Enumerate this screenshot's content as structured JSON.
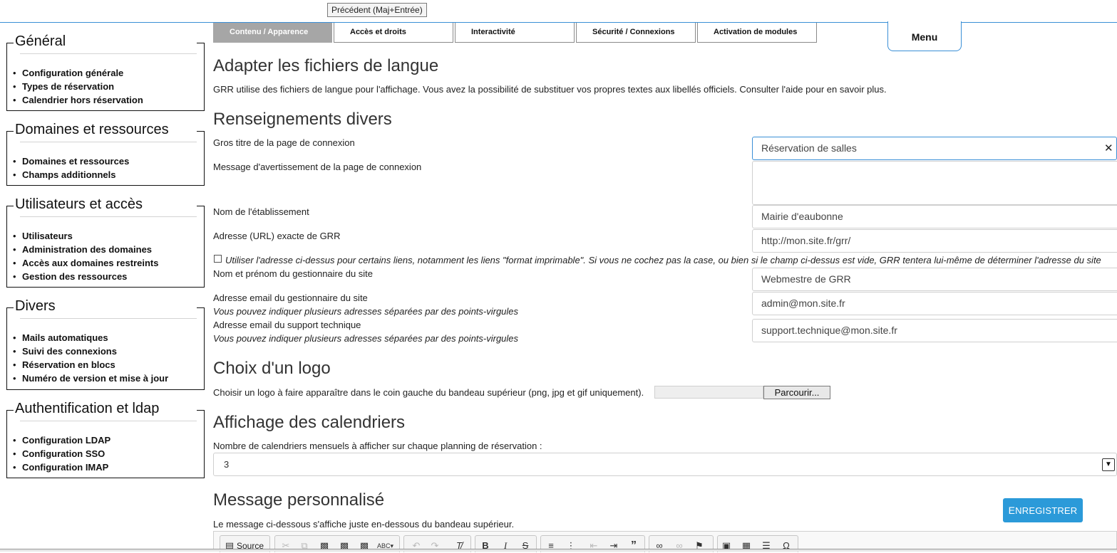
{
  "tooltip": "Précédent (Maj+Entrée)",
  "sidebar": [
    {
      "title": "Général",
      "items": [
        "Configuration générale",
        "Types de réservation",
        "Calendrier hors réservation"
      ]
    },
    {
      "title": "Domaines et ressources",
      "items": [
        "Domaines et ressources",
        "Champs additionnels"
      ]
    },
    {
      "title": "Utilisateurs et accès",
      "items": [
        "Utilisateurs",
        "Administration des domaines",
        "Accès aux domaines restreints",
        "Gestion des ressources"
      ]
    },
    {
      "title": "Divers",
      "items": [
        "Mails automatiques",
        "Suivi des connexions",
        "Réservation en blocs",
        "Numéro de version et mise à jour"
      ]
    },
    {
      "title": "Authentification et ldap",
      "items": [
        "Configuration LDAP",
        "Configuration SSO",
        "Configuration IMAP"
      ]
    }
  ],
  "tabs": [
    "Contenu / Apparence",
    "Accès et droits",
    "Interactivité",
    "Sécurité / Connexions",
    "Activation de modules"
  ],
  "menu_label": "Menu",
  "sections": {
    "lang_title": "Adapter les fichiers de langue",
    "lang_text": "GRR utilise des fichiers de langue pour l'affichage. Vous avez la possibilité de substituer vos propres textes aux libellés officiels. Consulter l'aide pour en savoir plus.",
    "misc_title": "Renseignements divers",
    "logo_title": "Choix d'un logo",
    "cal_title": "Affichage des calendriers",
    "msg_title": "Message personnalisé"
  },
  "fields": {
    "big_title_label": "Gros titre de la page de connexion",
    "big_title_value": "Réservation de salles",
    "warning_label": "Message d'avertissement de la page de connexion",
    "warning_value": "",
    "org_label": "Nom de l'établissement",
    "org_value": "Mairie d'eaubonne",
    "url_label": "Adresse (URL) exacte de GRR",
    "url_value": "http://mon.site.fr/grr/",
    "url_checkbox_text": "Utiliser l'adresse ci-dessus pour certains liens, notamment les liens \"format imprimable\". Si vous ne cochez pas la case, ou bien si le champ ci-dessus est vide, GRR tentera lui-même de déterminer l'adresse du site",
    "webmaster_label": "Nom et prénom du gestionnaire du site",
    "webmaster_value": "Webmestre de GRR",
    "admin_email_label": "Adresse email du gestionnaire du site",
    "admin_email_hint": "Vous pouvez indiquer plusieurs adresses séparées par des points-virgules",
    "admin_email_value": "admin@mon.site.fr",
    "support_email_label": "Adresse email du support technique",
    "support_email_hint": "Vous pouvez indiquer plusieurs adresses séparées par des points-virgules",
    "support_email_value": "support.technique@mon.site.fr"
  },
  "logo": {
    "label": "Choisir un logo à faire apparaître dans le coin gauche du bandeau supérieur (png, jpg et gif uniquement).",
    "browse": "Parcourir..."
  },
  "calendars": {
    "label": "Nombre de calendriers mensuels à afficher sur chaque planning de réservation :",
    "value": "3"
  },
  "message": {
    "text": "Le message ci-dessous s'affiche juste en-dessous du bandeau supérieur.",
    "save_first": "E",
    "save_rest": "NREGISTRER",
    "source": "Source"
  },
  "icons": {
    "clear": "✕",
    "select_arrow": "▼",
    "bullet": "•"
  }
}
